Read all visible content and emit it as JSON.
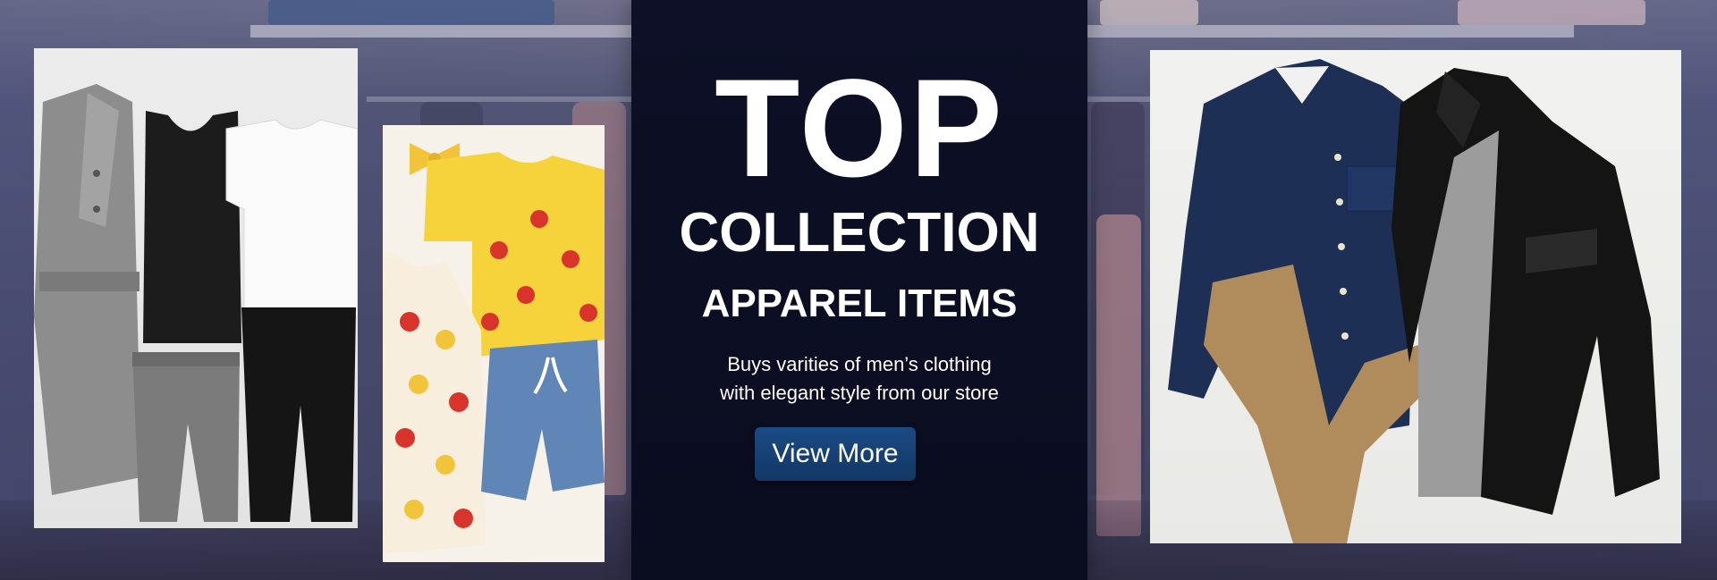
{
  "banner": {
    "headline": "TOP",
    "subheadline": "COLLECTION",
    "category": "APPAREL ITEMS",
    "tagline_lines": [
      "Buys varities of men’s clothing",
      "with elegant style from our store"
    ],
    "cta_label": "View More"
  },
  "images": {
    "left": "womens-outfit-photo",
    "middle": "kids-fruit-print-outfit-photo",
    "right": "mens-outfit-photo"
  },
  "colors": {
    "panel": "#0b0d22",
    "cta": "#123865",
    "text": "#ffffff"
  }
}
